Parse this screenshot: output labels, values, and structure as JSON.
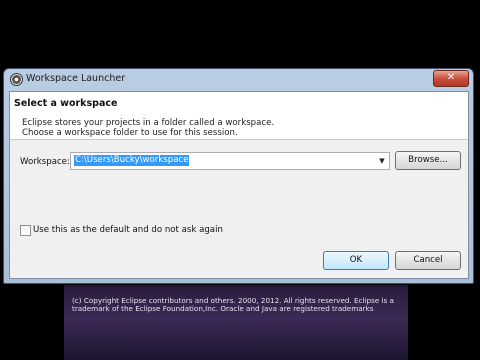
{
  "window": {
    "title": "Workspace Launcher",
    "close_glyph": "✕",
    "app_icon": "eclipse-icon"
  },
  "header": {
    "title": "Select a workspace",
    "description_lines": [
      "Eclipse stores your projects in a folder called a workspace.",
      "Choose a workspace folder to use for this session."
    ]
  },
  "workspace": {
    "label": "Workspace:",
    "value": "C:\\Users\\Bucky\\workspace",
    "dropdown_icon": "chevron-down-icon",
    "browse_label": "Browse..."
  },
  "default_option": {
    "label": "Use this as the default and do not ask again",
    "checked": false
  },
  "buttons": {
    "ok": "OK",
    "cancel": "Cancel"
  },
  "splash": {
    "copyright": "(c) Copyright Eclipse contributors and others. 2000, 2012.  All rights reserved. Eclipse is a trademark of the Eclipse Foundation,Inc. Oracle and Java are registered trademarks"
  }
}
